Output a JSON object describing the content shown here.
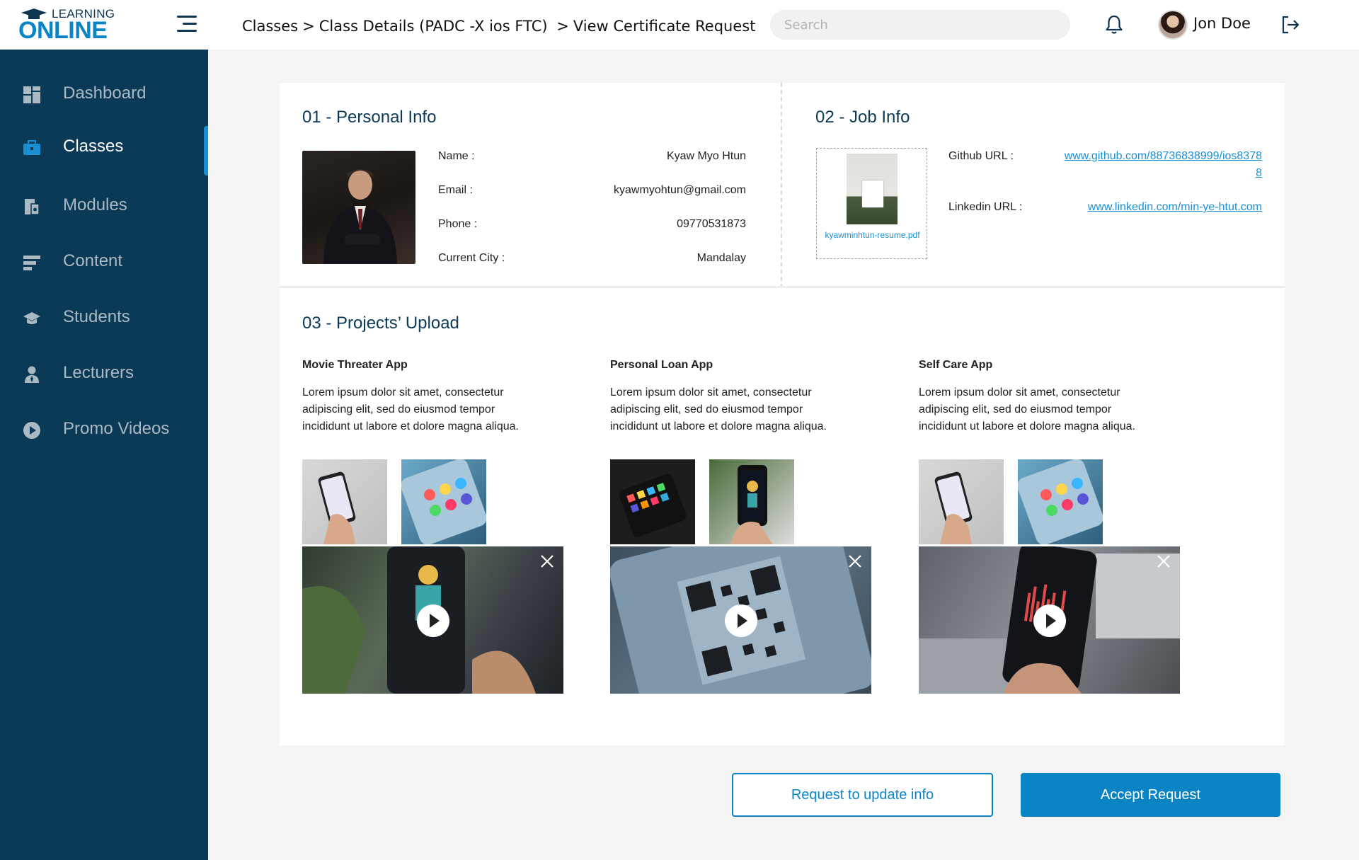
{
  "header": {
    "logo_small": "LEARNING",
    "logo_big": "ONLINE",
    "breadcrumb": [
      "Classes",
      ">",
      "Class Details (PADC -X ios FTC)",
      ">",
      "View Certificate Request"
    ],
    "search_placeholder": "Search",
    "user_name": "Jon Doe"
  },
  "sidebar": {
    "items": [
      {
        "label": "Dashboard",
        "icon": "dashboard-icon"
      },
      {
        "label": "Classes",
        "icon": "briefcase-icon",
        "active": true
      },
      {
        "label": "Modules",
        "icon": "modules-icon"
      },
      {
        "label": "Content",
        "icon": "content-icon"
      },
      {
        "label": "Students",
        "icon": "graduation-cap-icon"
      },
      {
        "label": "Lecturers",
        "icon": "lecturer-icon"
      },
      {
        "label": "Promo Videos",
        "icon": "play-circle-icon"
      }
    ]
  },
  "personal": {
    "title": "01 - Personal Info",
    "fields": [
      {
        "label": "Name :",
        "value": "Kyaw Myo Htun"
      },
      {
        "label": "Email :",
        "value": "kyawmyohtun@gmail.com"
      },
      {
        "label": "Phone :",
        "value": "09770531873"
      },
      {
        "label": "Current City :",
        "value": "Mandalay"
      }
    ]
  },
  "job": {
    "title": "02 - Job Info",
    "resume_name": "kyawminhtun-resume.pdf",
    "github_label": "Github URL :",
    "github_url": "www.github.com/88736838999/ios83788",
    "linkedin_label": "Linkedin URL :",
    "linkedin_url": "www.linkedin.com/min-ye-htut.com"
  },
  "projects": {
    "title": "03 - Projects’ Upload",
    "items": [
      {
        "name": "Movie Threater App",
        "desc": "Lorem ipsum dolor sit amet, consectetur adipiscing elit, sed do eiusmod tempor incididunt ut labore et dolore magna aliqua."
      },
      {
        "name": "Personal Loan App",
        "desc": "Lorem ipsum dolor sit amet, consectetur adipiscing elit, sed do eiusmod tempor incididunt ut labore et dolore magna aliqua."
      },
      {
        "name": "Self Care App",
        "desc": "Lorem ipsum dolor sit amet, consectetur adipiscing elit, sed do eiusmod tempor incididunt ut labore et dolore magna aliqua."
      }
    ]
  },
  "actions": {
    "request_update": "Request to update info",
    "accept": "Accept Request"
  },
  "colors": {
    "sidebar_bg": "#0b3a56",
    "accent": "#0b84c6",
    "link": "#1a8fd4"
  }
}
